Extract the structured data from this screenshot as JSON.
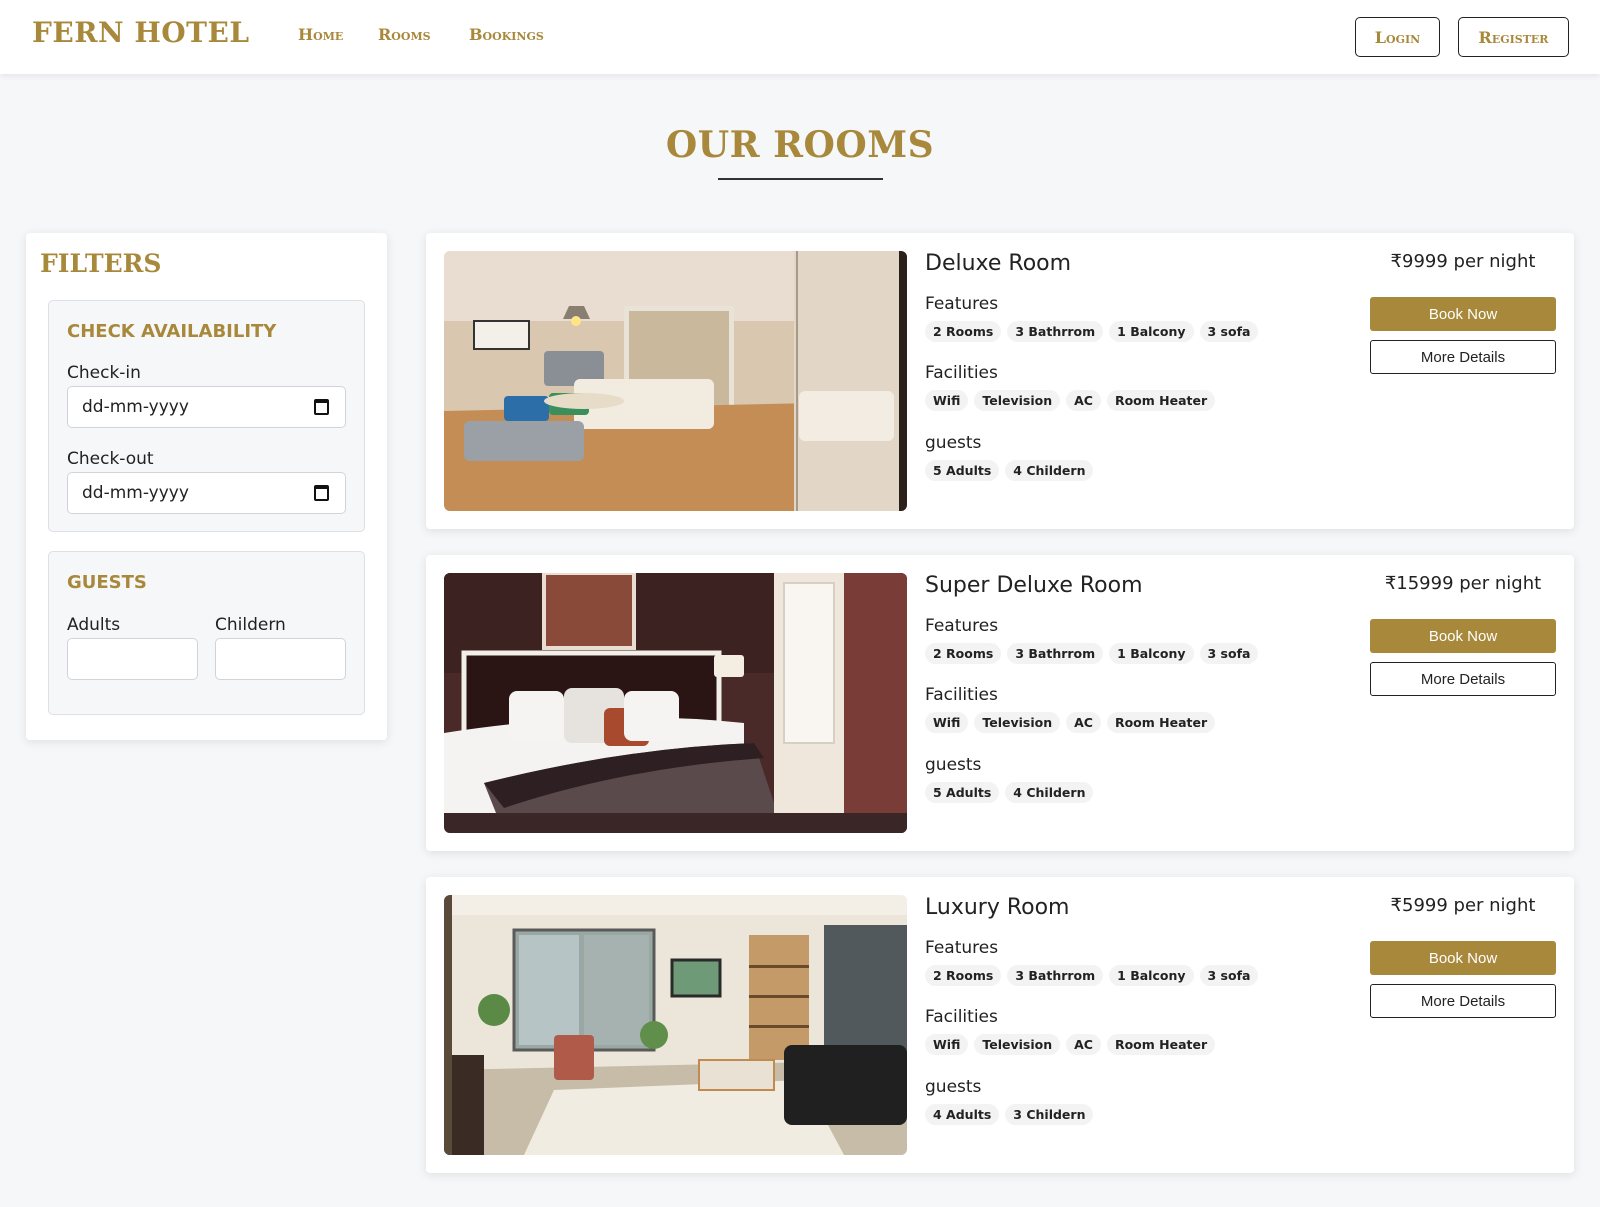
{
  "navbar": {
    "brand": "FERN HOTEL",
    "links": [
      "Home",
      "Rooms",
      "Bookings"
    ],
    "login_label": "Login",
    "register_label": "Register"
  },
  "page": {
    "title": "OUR ROOMS"
  },
  "filters": {
    "title": "FILTERS",
    "availability": {
      "title": "CHECK AVAILABILITY",
      "checkin_label": "Check-in",
      "checkin_value": "dd-mm-yyyy",
      "checkout_label": "Check-out",
      "checkout_value": "dd-mm-yyyy"
    },
    "guests": {
      "title": "GUESTS",
      "adults_label": "Adults",
      "children_label": "Childern",
      "adults_value": "",
      "children_value": ""
    }
  },
  "rooms": [
    {
      "name": "Deluxe Room",
      "price": "₹9999 per night",
      "features_label": "Features",
      "features": [
        "2 Rooms",
        "3 Bathrrom",
        "1 Balcony",
        "3 sofa"
      ],
      "facilities_label": "Facilities",
      "facilities": [
        "Wifi",
        "Television",
        "AC",
        "Room Heater"
      ],
      "guests_label": "guests",
      "guests": [
        "5 Adults",
        "4 Childern"
      ],
      "book_label": "Book Now",
      "details_label": "More Details"
    },
    {
      "name": "Super Deluxe Room",
      "price": "₹15999 per night",
      "features_label": "Features",
      "features": [
        "2 Rooms",
        "3 Bathrrom",
        "1 Balcony",
        "3 sofa"
      ],
      "facilities_label": "Facilities",
      "facilities": [
        "Wifi",
        "Television",
        "AC",
        "Room Heater"
      ],
      "guests_label": "guests",
      "guests": [
        "5 Adults",
        "4 Childern"
      ],
      "book_label": "Book Now",
      "details_label": "More Details"
    },
    {
      "name": "Luxury Room",
      "price": "₹5999 per night",
      "features_label": "Features",
      "features": [
        "2 Rooms",
        "3 Bathrrom",
        "1 Balcony",
        "3 sofa"
      ],
      "facilities_label": "Facilities",
      "facilities": [
        "Wifi",
        "Television",
        "AC",
        "Room Heater"
      ],
      "guests_label": "guests",
      "guests": [
        "4 Adults",
        "3 Childern"
      ],
      "book_label": "Book Now",
      "details_label": "More Details"
    }
  ],
  "colors": {
    "accent": "#a8883a",
    "background": "#f6f7f9"
  }
}
